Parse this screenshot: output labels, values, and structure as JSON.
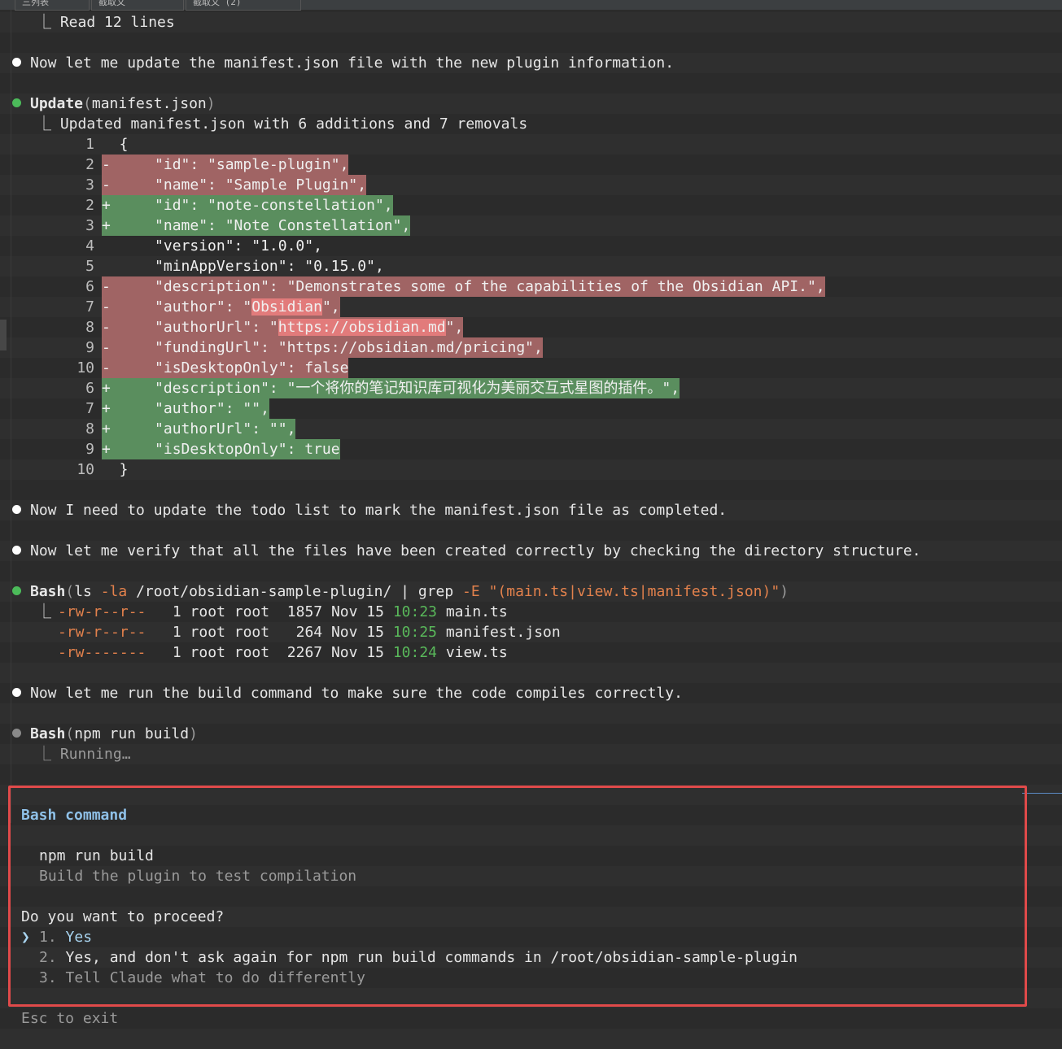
{
  "tabs": [
    "三列表",
    "截取文",
    "截取文 (2)"
  ],
  "read_result": "⎿ Read 12 lines",
  "msg1": "Now let me update the manifest.json file with the new plugin information.",
  "update": {
    "tool": "Update",
    "arg": "manifest.json",
    "summary": "⎿ Updated manifest.json with 6 additions and 7 removals"
  },
  "diff": [
    {
      "n": "1",
      "type": "ctx",
      "code": "  {"
    },
    {
      "n": "2",
      "type": "del",
      "code": "-     \"id\": \"sample-plugin\","
    },
    {
      "n": "3",
      "type": "del",
      "code": "-     \"name\": \"Sample Plugin\","
    },
    {
      "n": "2",
      "type": "add",
      "code": "+     \"id\": \"note-constellation\","
    },
    {
      "n": "3",
      "type": "add",
      "code": "+     \"name\": \"Note Constellation\","
    },
    {
      "n": "4",
      "type": "ctx",
      "code": "      \"version\": \"1.0.0\","
    },
    {
      "n": "5",
      "type": "ctx",
      "code": "      \"minAppVersion\": \"0.15.0\","
    },
    {
      "n": "6",
      "type": "del",
      "code": "-     \"description\": \"Demonstrates some of the capabilities of the Obsidian API.\","
    },
    {
      "n": "7",
      "type": "del",
      "code": "-     \"author\": \"Obsidian\","
    },
    {
      "n": "8",
      "type": "del",
      "code": "-     \"authorUrl\": \"https://obsidian.md\","
    },
    {
      "n": "9",
      "type": "del",
      "code": "-     \"fundingUrl\": \"https://obsidian.md/pricing\","
    },
    {
      "n": "10",
      "type": "del",
      "code": "-     \"isDesktopOnly\": false"
    },
    {
      "n": "6",
      "type": "add",
      "code": "+     \"description\": \"一个将你的笔记知识库可视化为美丽交互式星图的插件。\","
    },
    {
      "n": "7",
      "type": "add",
      "code": "+     \"author\": \"\","
    },
    {
      "n": "8",
      "type": "add",
      "code": "+     \"authorUrl\": \"\","
    },
    {
      "n": "9",
      "type": "add",
      "code": "+     \"isDesktopOnly\": true"
    },
    {
      "n": "10",
      "type": "ctx",
      "code": "  }"
    }
  ],
  "msg2": "Now I need to update the todo list to mark the manifest.json file as completed.",
  "msg3": "Now let me verify that all the files have been created correctly by checking the directory structure.",
  "bash1": {
    "tool": "Bash",
    "cmd_a": "ls ",
    "flag1": "-la",
    "cmd_b": " /root/obsidian-sample-plugin/ | grep ",
    "flag2": "-E",
    "pattern": " \"(main.ts|view.ts|manifest.json)\"",
    "files": [
      {
        "perm": "-rw-r--r--",
        "mid": "   1 root root  1857 Nov 15 ",
        "time": "10:23",
        "name": " main.ts"
      },
      {
        "perm": "-rw-r--r--",
        "mid": "   1 root root   264 Nov 15 ",
        "time": "10:25",
        "name": " manifest.json"
      },
      {
        "perm": "-rw-------",
        "mid": "   1 root root  2267 Nov 15 ",
        "time": "10:24",
        "name": " view.ts"
      }
    ]
  },
  "msg4": "Now let me run the build command to make sure the code compiles correctly.",
  "bash2": {
    "tool": "Bash",
    "cmd": "npm run build",
    "status": "⎿ Running…"
  },
  "permission": {
    "title": "Bash command",
    "command": "npm run build",
    "description": "Build the plugin to test compilation",
    "question": "Do you want to proceed?",
    "cursor": "❯",
    "options": [
      {
        "num": "1.",
        "label": "Yes"
      },
      {
        "num": "2.",
        "label": "Yes, and don't ask again for npm run build commands in /root/obsidian-sample-plugin"
      },
      {
        "num": "3.",
        "label": "Tell Claude what to do differently"
      }
    ]
  },
  "footer": "Esc to exit",
  "colors": {
    "background": "#2b2b2b",
    "added": "#5a8e5e",
    "removed": "#a06464",
    "border": "#e04a4a",
    "accent": "#8fc1e8"
  }
}
